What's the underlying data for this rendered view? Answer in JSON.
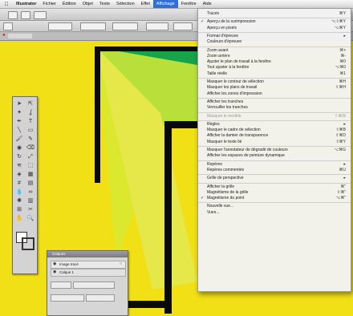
{
  "menubar": {
    "apple_glyph": "",
    "items": [
      {
        "label": "Illustrator",
        "bold": true
      },
      {
        "label": "Fichier"
      },
      {
        "label": "Édition"
      },
      {
        "label": "Objet"
      },
      {
        "label": "Texte"
      },
      {
        "label": "Sélection"
      },
      {
        "label": "Effet"
      },
      {
        "label": "Affichage",
        "active": true
      },
      {
        "label": "Fenêtre"
      },
      {
        "label": "Aide"
      }
    ]
  },
  "canvas": {
    "artwork_colors": {
      "yellow": "#f2e016",
      "green_dark": "#16a34a",
      "green_mid": "#2fbf3a",
      "lime": "#b9e03a",
      "yellow_green": "#dbe82e",
      "black": "#0a0a0a"
    }
  },
  "tools_panel": {
    "icons": [
      "selection-arrow",
      "direct-selection",
      "magic-wand",
      "lasso",
      "pen",
      "type",
      "line",
      "rectangle",
      "paintbrush",
      "pencil",
      "blob-brush",
      "eraser",
      "rotate",
      "scale",
      "width",
      "free-transform",
      "shape-builder",
      "perspective-grid",
      "mesh",
      "gradient",
      "eyedropper",
      "blend",
      "symbol-sprayer",
      "column-graph",
      "artboard",
      "slice",
      "hand",
      "zoom"
    ]
  },
  "floating_panel": {
    "title": "Calques",
    "row1": "Image tracé",
    "row2": "Calque 1"
  },
  "view_menu": {
    "items": [
      {
        "label": "Tracés",
        "shortcut": "⌘Y"
      },
      {
        "sep": true
      },
      {
        "label": "Aperçu de la surimpression",
        "shortcut": "⌥⇧⌘Y",
        "checked": true
      },
      {
        "label": "Aperçu en pixels",
        "shortcut": "⌥⌘Y"
      },
      {
        "sep": true
      },
      {
        "label": "Format d'épreuve",
        "shortcut": "▸"
      },
      {
        "label": "Couleurs d'épreuve",
        "shortcut": ""
      },
      {
        "sep": true
      },
      {
        "label": "Zoom avant",
        "shortcut": "⌘+"
      },
      {
        "label": "Zoom arrière",
        "shortcut": "⌘-"
      },
      {
        "label": "Ajuster le plan de travail à la fenêtre",
        "shortcut": "⌘0"
      },
      {
        "label": "Tout ajuster à la fenêtre",
        "shortcut": "⌥⌘0"
      },
      {
        "label": "Taille réelle",
        "shortcut": "⌘1"
      },
      {
        "sep": true
      },
      {
        "label": "Masquer le contour de sélection",
        "shortcut": "⌘H"
      },
      {
        "label": "Masquer les plans de travail",
        "shortcut": "⇧⌘H"
      },
      {
        "label": "Afficher les zones d'impression",
        "shortcut": ""
      },
      {
        "sep": true
      },
      {
        "label": "Afficher les tranches",
        "shortcut": ""
      },
      {
        "label": "Verrouiller les tranches",
        "shortcut": ""
      },
      {
        "sep": true
      },
      {
        "label": "Masquer le modèle",
        "shortcut": "⇧⌘W",
        "disabled": true
      },
      {
        "sep": true
      },
      {
        "label": "Règles",
        "shortcut": "▸"
      },
      {
        "label": "Masquer le cadre de sélection",
        "shortcut": "⇧⌘B"
      },
      {
        "label": "Afficher la damier de transparence",
        "shortcut": "⇧⌘D"
      },
      {
        "label": "Masquer le texte lié",
        "shortcut": "⇧⌘Y"
      },
      {
        "sep": true
      },
      {
        "label": "Masquer l'annotateur de dégradé de couleurs",
        "shortcut": "⌥⌘G"
      },
      {
        "label": "Afficher les espaces de peinture dynamique",
        "shortcut": ""
      },
      {
        "sep": true
      },
      {
        "label": "Repères",
        "shortcut": "▸"
      },
      {
        "label": "Repères commentés",
        "shortcut": "⌘U"
      },
      {
        "sep": true
      },
      {
        "label": "Grille de perspective",
        "shortcut": "▸"
      },
      {
        "sep": true
      },
      {
        "label": "Afficher la grille",
        "shortcut": "⌘\""
      },
      {
        "label": "Magnétisme de la grille",
        "shortcut": "⇧⌘\""
      },
      {
        "label": "Magnétisme du point",
        "shortcut": "⌥⌘\"",
        "checked": true
      },
      {
        "sep": true
      },
      {
        "label": "Nouvelle vue...",
        "shortcut": ""
      },
      {
        "label": "Vues...",
        "shortcut": ""
      }
    ]
  }
}
